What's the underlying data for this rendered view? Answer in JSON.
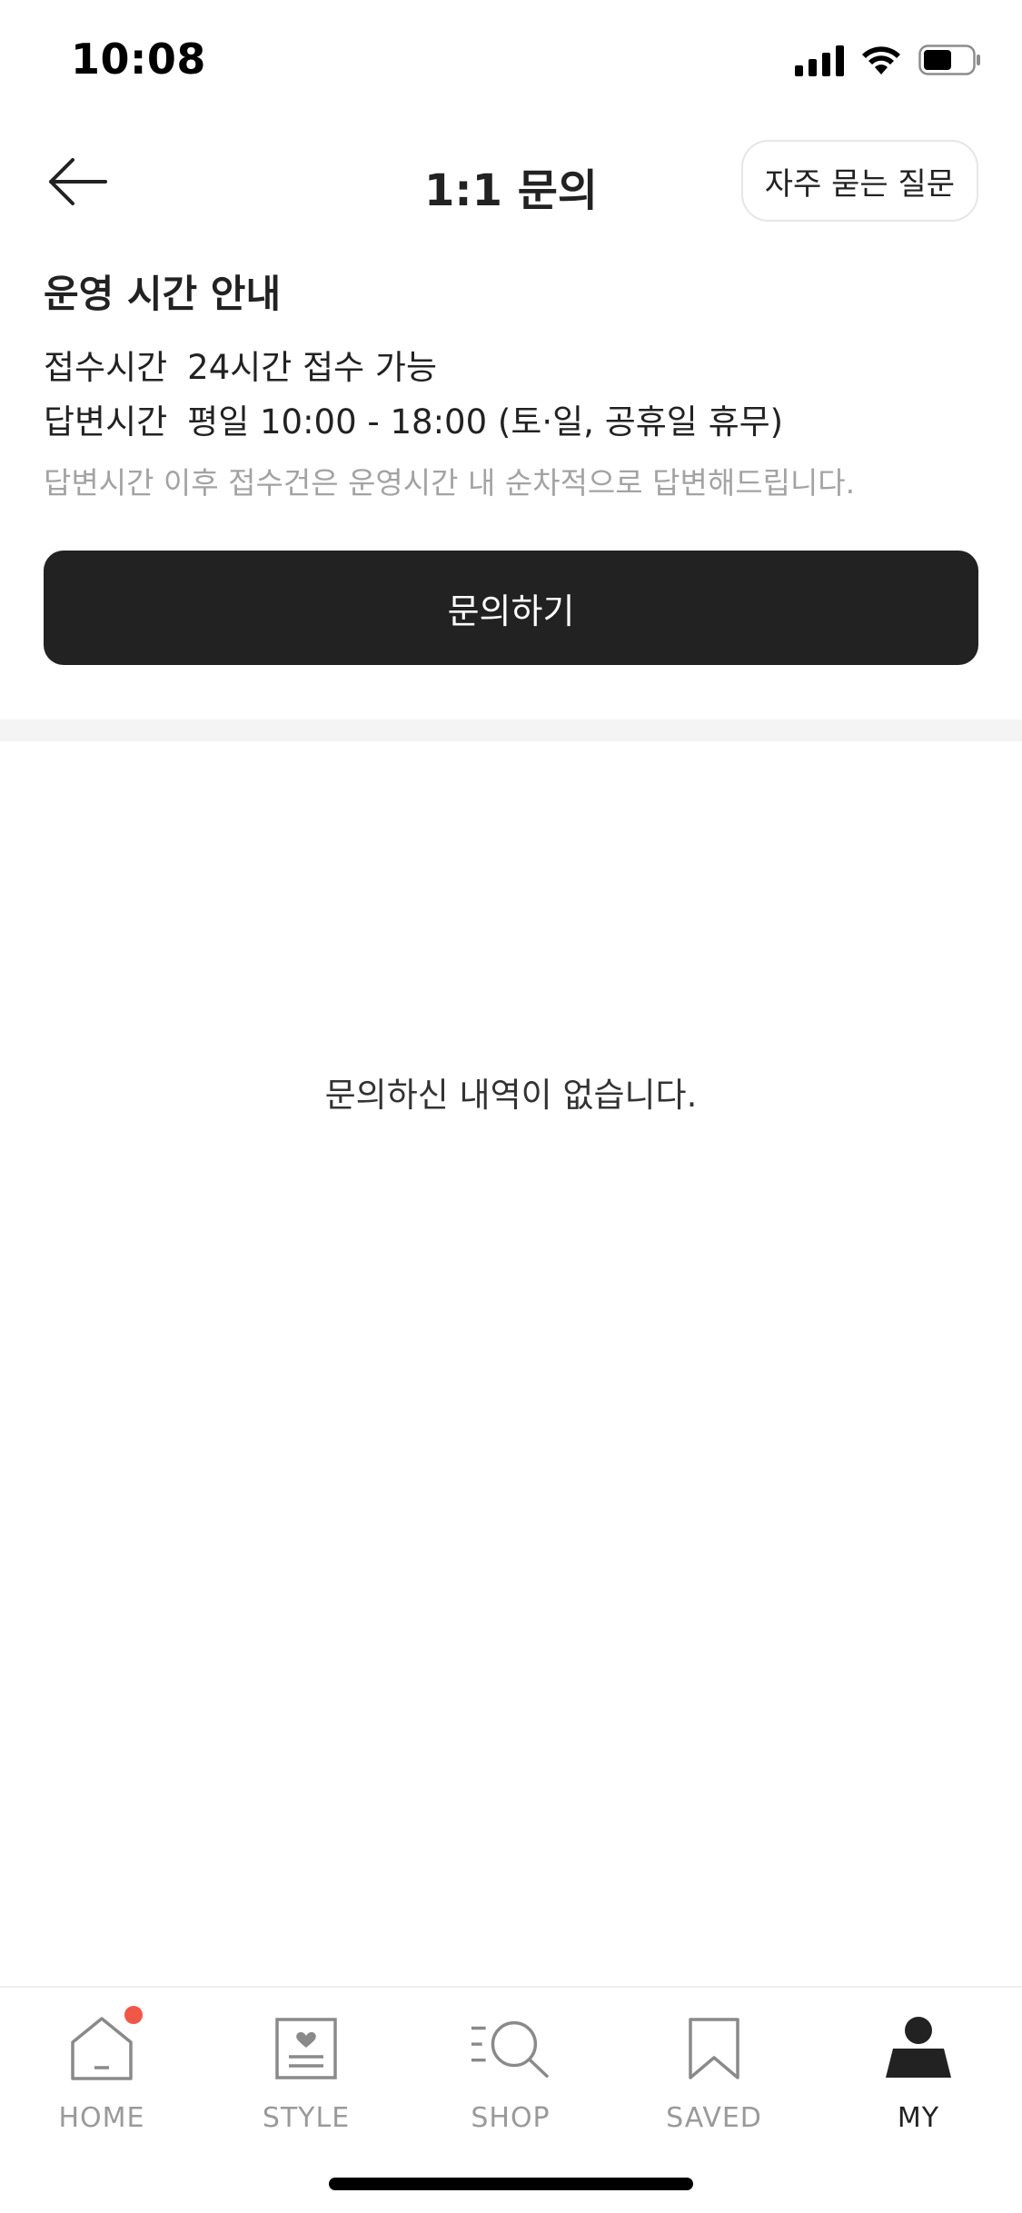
{
  "status_bar": {
    "time": "10:08"
  },
  "header": {
    "title": "1:1 문의",
    "faq_button_label": "자주 묻는 질문"
  },
  "info": {
    "title": "운영 시간 안내",
    "reception_label": "접수시간",
    "reception_value": "24시간 접수 가능",
    "answer_label": "답변시간",
    "answer_value": "평일 10:00 - 18:00 (토·일, 공휴일 휴무)",
    "note": "답변시간 이후 접수건은 운영시간 내 순차적으로 답변해드립니다."
  },
  "inquiry_button_label": "문의하기",
  "empty_message": "문의하신 내역이 없습니다.",
  "bottom_nav": {
    "items": [
      {
        "label": "HOME",
        "icon": "home-icon",
        "active": false,
        "badge": true
      },
      {
        "label": "STYLE",
        "icon": "style-icon",
        "active": false,
        "badge": false
      },
      {
        "label": "SHOP",
        "icon": "shop-search-icon",
        "active": false,
        "badge": false
      },
      {
        "label": "SAVED",
        "icon": "bookmark-icon",
        "active": false,
        "badge": false
      },
      {
        "label": "MY",
        "icon": "profile-icon",
        "active": true,
        "badge": false
      }
    ]
  },
  "colors": {
    "primary": "#222222",
    "badge": "#f15746",
    "inactive": "#9a9a9a",
    "note": "#a3a3a3"
  }
}
